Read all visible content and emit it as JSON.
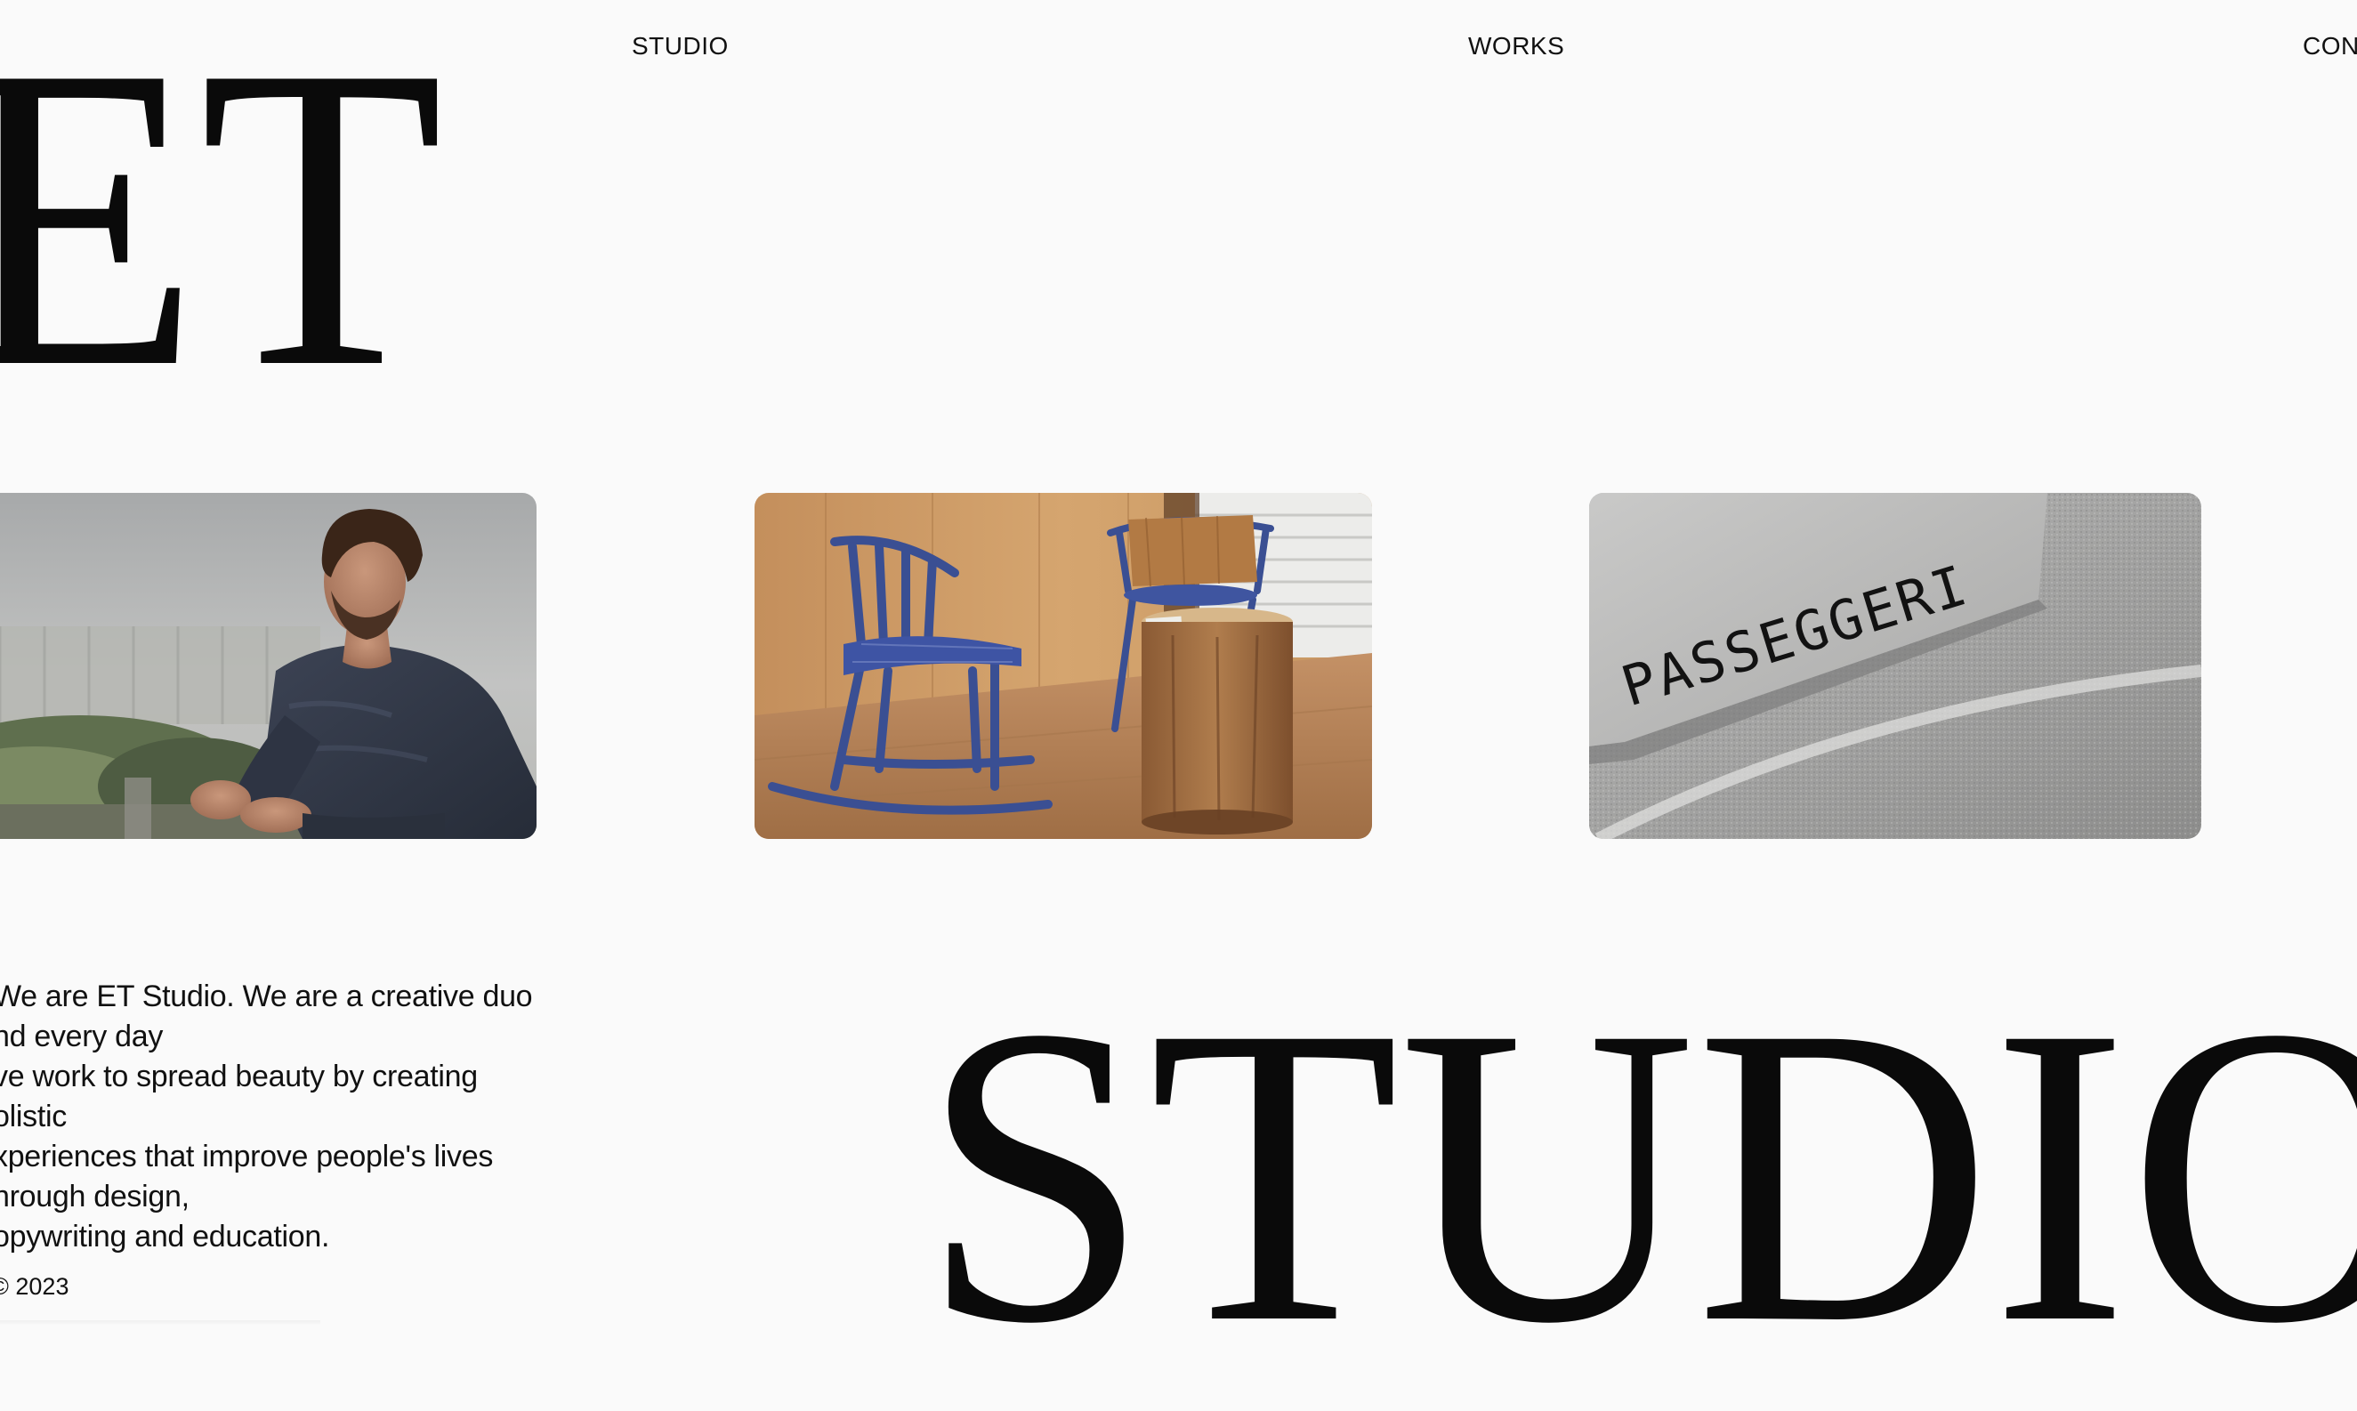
{
  "brand": {
    "wordmark_top": "ET",
    "wordmark_bottom": "STUDIO"
  },
  "nav": {
    "studio": "STUDIO",
    "works": "WORKS",
    "contact": "CON"
  },
  "cards": [
    {
      "name": "portrait",
      "subject": "man in navy t-shirt outdoors"
    },
    {
      "name": "chairs",
      "subject": "blue rocking chairs with wooden stump"
    },
    {
      "name": "sign",
      "subject": "metal sign on concrete",
      "sign_text": "PASSEGGERI"
    }
  ],
  "intro": {
    "lines": [
      "We are ET Studio. We are a creative duo",
      "nd every day",
      "ve work to spread beauty by creating",
      "olistic",
      "xperiences that improve people's lives",
      "nrough design,",
      "opywriting and education."
    ],
    "copyright": "© 2023"
  },
  "colors": {
    "background": "#fafafa",
    "text": "#0c0c0c"
  }
}
